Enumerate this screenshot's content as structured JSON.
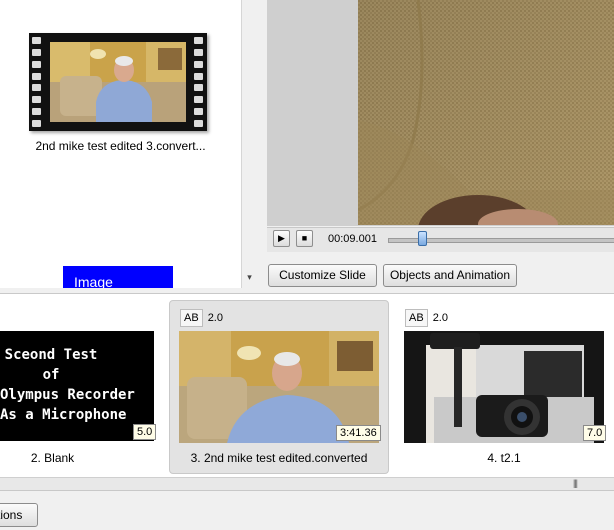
{
  "browser": {
    "thumbnail_caption": "2nd mike test edited 3.convert...",
    "image_tile_label": "Image",
    "scroll_down_icon": "▾"
  },
  "preview": {
    "play_icon": "▶",
    "stop_icon": "■",
    "time": "00:09.001",
    "timeline_progress": 0.15
  },
  "buttons": {
    "customize_slide": "Customize Slide",
    "objects_animation": "Objects and Animation"
  },
  "storyboard": {
    "slides": [
      {
        "number": 2,
        "caption": "2. Blank",
        "duration": "5.0",
        "text_lines": [
          "Sceond Test",
          "of",
          "Olympus Recorder",
          "As a Microphone"
        ]
      },
      {
        "number": 3,
        "caption": "3. 2nd mike test edited.converted",
        "duration": "3:41.36",
        "ab_label": "AB",
        "transition": "2.0",
        "selected": true
      },
      {
        "number": 4,
        "caption": "4. t2.1",
        "duration": "7.0",
        "ab_label": "AB",
        "transition": "2.0"
      }
    ]
  },
  "footer": {
    "options_label": "tions",
    "grip_icon": "|||"
  },
  "colors": {
    "image_tile": "#0000ff",
    "selected_slide_bg": "#e3e3e3"
  }
}
